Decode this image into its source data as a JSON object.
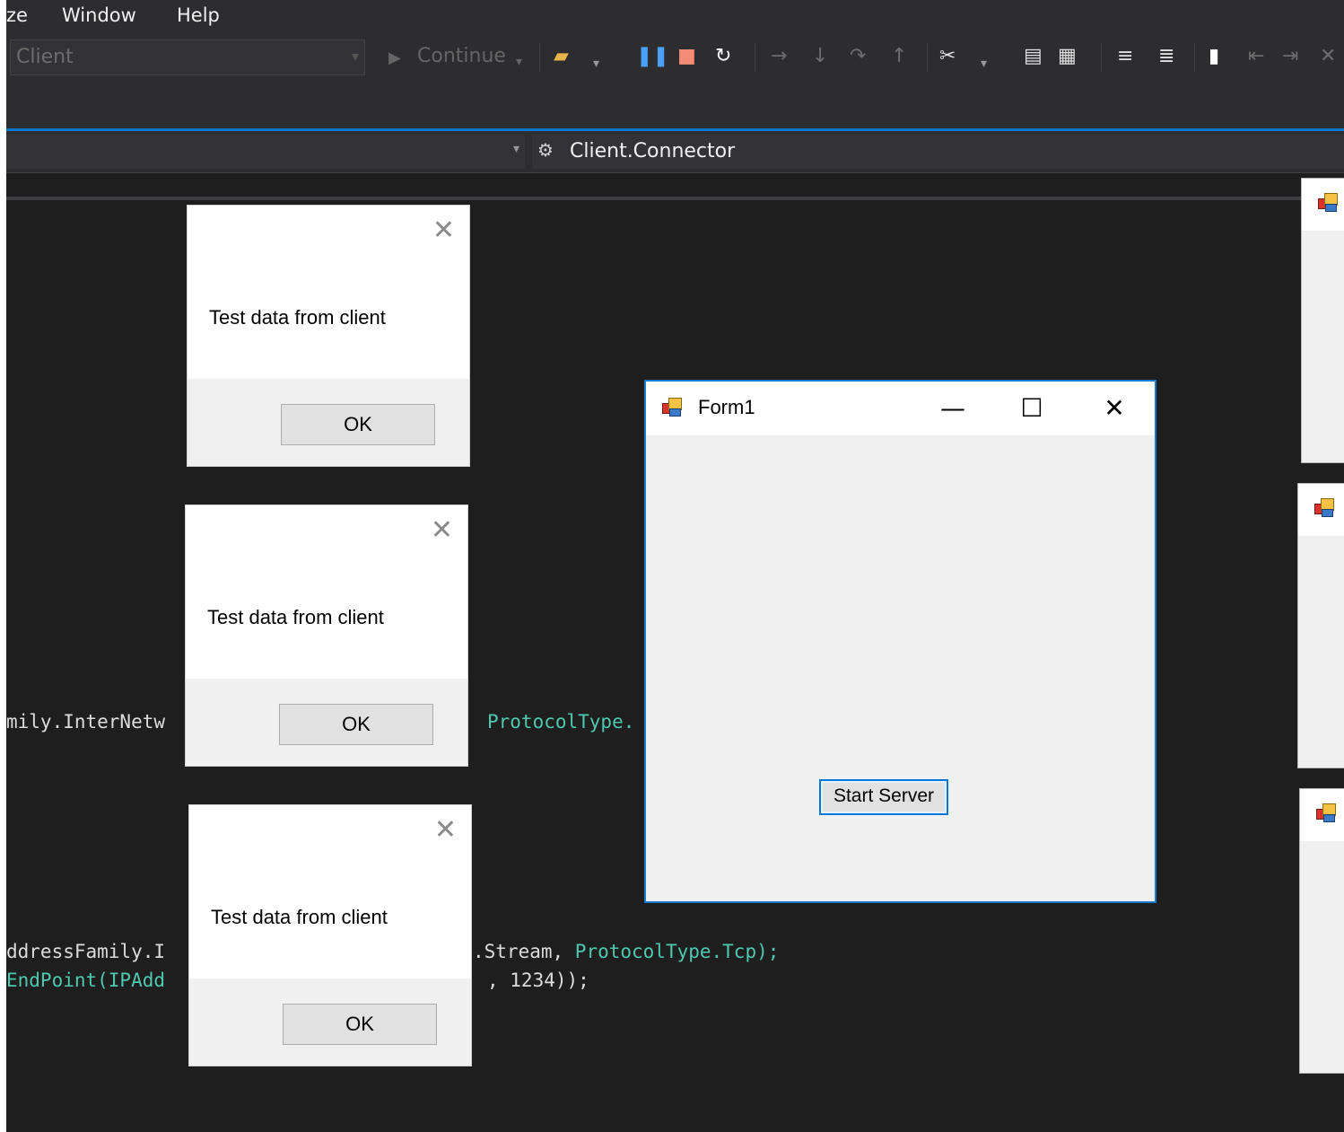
{
  "menu": {
    "items": [
      "ze",
      "Window",
      "Help"
    ]
  },
  "toolbar": {
    "configuration": "Client",
    "continue_label": "Continue",
    "icons": [
      "process-icon",
      "pause-icon",
      "stop-icon",
      "restart-icon",
      "show-next-statement-icon",
      "step-into-icon",
      "step-over-icon",
      "step-out-icon",
      "breakpoint-icon",
      "bookmark-icon"
    ]
  },
  "navbar": {
    "member": "Client.Connector"
  },
  "code": {
    "line1_left": "mily.InterNetw",
    "line1_right": "ProtocolType.",
    "line2_left": "ddressFamily.I",
    "line2_right_a": ".Stream, ",
    "line2_right_b": "ProtocolType.Tcp);",
    "line3_left": "EndPoint(IPAdd",
    "line3_right": ", 1234));"
  },
  "message_boxes": [
    {
      "text": "Test data from client",
      "ok_label": "OK",
      "close": "✕"
    },
    {
      "text": "Test data from client",
      "ok_label": "OK",
      "close": "✕"
    },
    {
      "text": "Test data from client",
      "ok_label": "OK",
      "close": "✕"
    }
  ],
  "form1": {
    "title": "Form1",
    "minimize": "—",
    "maximize": "☐",
    "close": "✕",
    "start_button": "Start Server"
  },
  "colors": {
    "ide_bg": "#1e1e1e",
    "accent": "#007acc",
    "form_border": "#1979ca"
  }
}
